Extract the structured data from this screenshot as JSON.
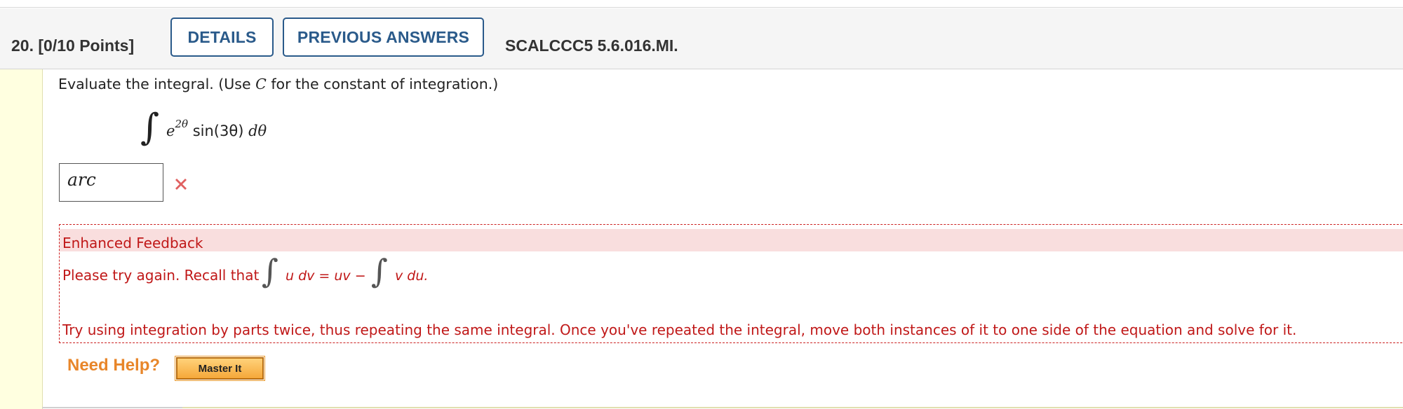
{
  "header": {
    "question_number": "20.",
    "points": "[0/10 Points]",
    "details_label": "DETAILS",
    "previous_answers_label": "PREVIOUS ANSWERS",
    "question_code": "SCALCCC5 5.6.016.MI."
  },
  "question": {
    "prompt_before": "Evaluate the integral. (Use ",
    "prompt_var": "C",
    "prompt_after": " for the constant of integration.)",
    "integral_symbol": "∫",
    "integrand_base": "e",
    "integrand_exp": "2θ",
    "integrand_rest": "sin(3θ)",
    "differential": "dθ"
  },
  "answer": {
    "value": "arc",
    "status_icon": "incorrect-x-icon"
  },
  "feedback": {
    "title": "Enhanced Feedback",
    "line1_prefix": "Please try again. Recall that",
    "formula_int": "∫",
    "formula_lhs": "u dv = uv −",
    "formula_rhs": "v du.",
    "line2": "Try using integration by parts twice, thus repeating the same integral. Once you've repeated the integral, move both instances of it to one side of the equation and solve for it."
  },
  "help": {
    "label": "Need Help?",
    "master_it_label": "Master It"
  },
  "colors": {
    "accent": "#2a5a8a",
    "error": "#c01818",
    "help": "#e8862a"
  }
}
